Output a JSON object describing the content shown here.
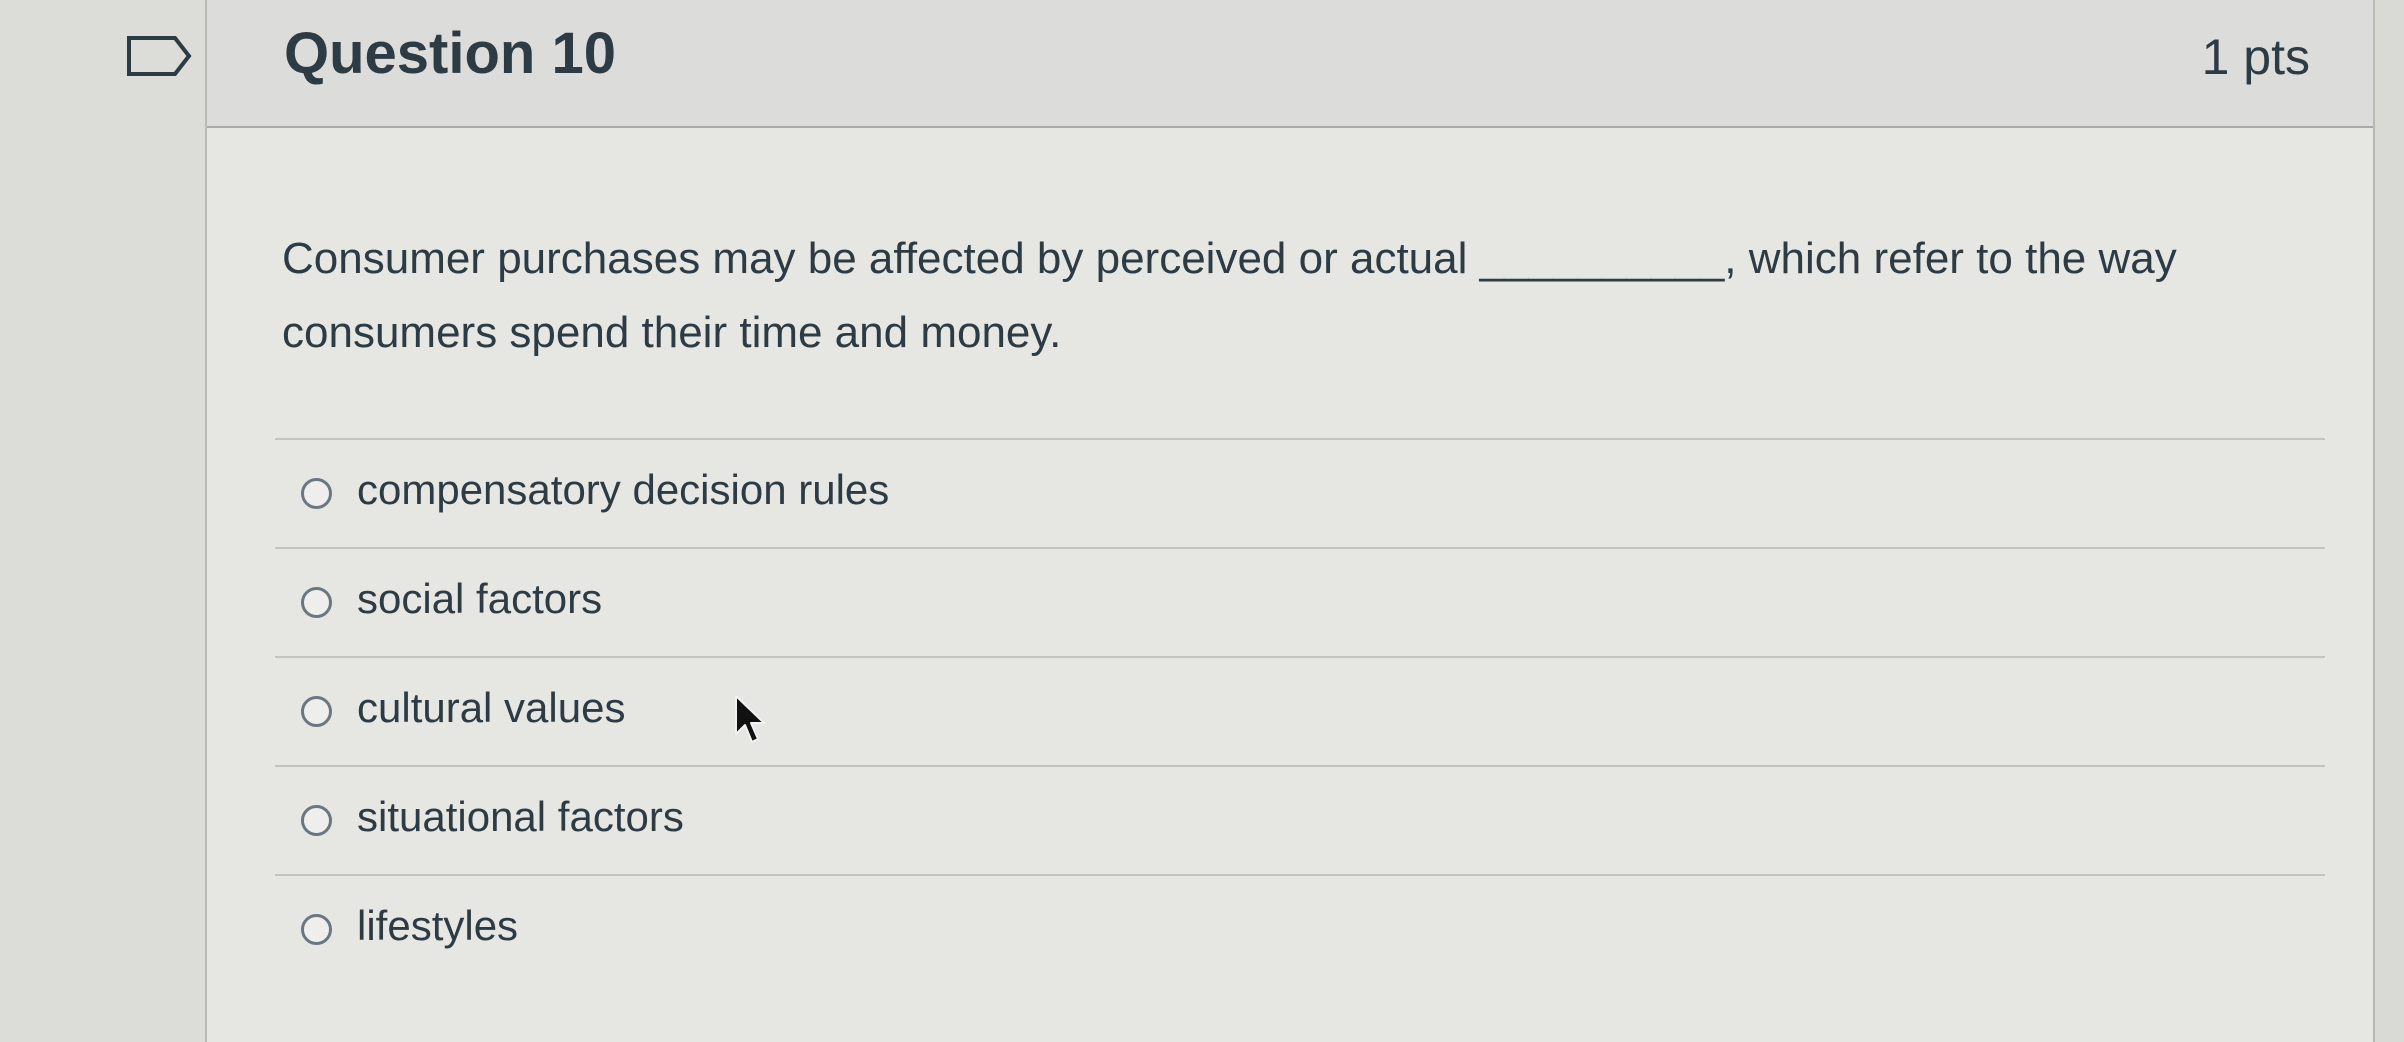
{
  "question": {
    "title": "Question 10",
    "points": "1 pts",
    "text": "Consumer purchases may be affected by perceived or actual __________, which refer to the way consumers spend their time and money."
  },
  "answers": [
    {
      "label": "compensatory decision rules",
      "selected": false
    },
    {
      "label": "social factors",
      "selected": false
    },
    {
      "label": "cultural values",
      "selected": false
    },
    {
      "label": "situational factors",
      "selected": false
    },
    {
      "label": "lifestyles",
      "selected": false
    }
  ],
  "icons": {
    "flag": "flag-bookmark-icon",
    "cursor": "mouse-pointer-icon"
  },
  "colors": {
    "text": "#2d3b45",
    "radio_border": "#6b7780",
    "background": "#e6e6e3"
  }
}
